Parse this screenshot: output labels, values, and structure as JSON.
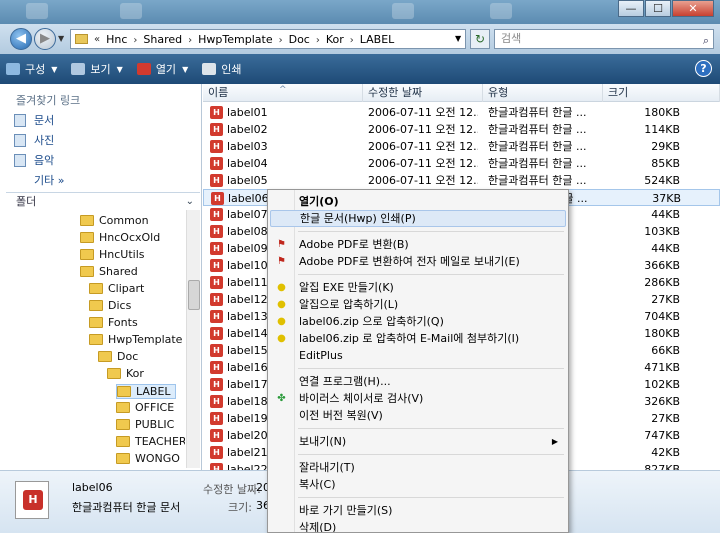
{
  "window": {
    "minimize_label": "—",
    "maximize_label": "☐",
    "close_label": "✕"
  },
  "address": {
    "history_glyph": "▼",
    "lead_glyph": "«",
    "crumbs": [
      "Hnc",
      "Shared",
      "HwpTemplate",
      "Doc",
      "Kor",
      "LABEL"
    ],
    "separator": "›",
    "dropdown_glyph": "▼",
    "refresh_glyph": "↻",
    "search_placeholder": "검색",
    "search_icon_glyph": "⌕"
  },
  "toolbar": {
    "organize": "구성",
    "views": "보기",
    "open": "열기",
    "print": "인쇄",
    "dropdown_glyph": "▼",
    "help": "?"
  },
  "nav": {
    "favorites_title": "즐겨찾기 링크",
    "favorites": [
      "문서",
      "사진",
      "음악"
    ],
    "more": "기타 »",
    "folders_label": "폴더",
    "folders_chevron": "⌄",
    "tree": [
      "Common",
      "HncOcxOld",
      "HncUtils",
      "Shared",
      "Clipart",
      "Dics",
      "Fonts",
      "HwpTemplate",
      "Doc",
      "Kor",
      "LABEL",
      "OFFICE",
      "PUBLIC",
      "TEACHER",
      "WONGO"
    ]
  },
  "list": {
    "sort_glyph": "^",
    "icon_glyph": "H",
    "columns": [
      "이름",
      "수정한 날짜",
      "유형",
      "크기"
    ],
    "rows": [
      {
        "name": "label01",
        "date": "2006-07-11 오전 12...",
        "type": "한글과컴퓨터 한글 ...",
        "size": "180KB"
      },
      {
        "name": "label02",
        "date": "2006-07-11 오전 12...",
        "type": "한글과컴퓨터 한글 ...",
        "size": "114KB"
      },
      {
        "name": "label03",
        "date": "2006-07-11 오전 12...",
        "type": "한글과컴퓨터 한글 ...",
        "size": "29KB"
      },
      {
        "name": "label04",
        "date": "2006-07-11 오전 12...",
        "type": "한글과컴퓨터 한글 ...",
        "size": "85KB"
      },
      {
        "name": "label05",
        "date": "2006-07-11 오전 12...",
        "type": "한글과컴퓨터 한글 ...",
        "size": "524KB"
      },
      {
        "name": "label06",
        "date": "2006-07-11 오전 12...",
        "type": "한글과컴퓨터 한글 ...",
        "size": "37KB"
      },
      {
        "name": "label07",
        "date": "",
        "type": "",
        "size": "44KB"
      },
      {
        "name": "label08",
        "date": "",
        "type": "",
        "size": "103KB"
      },
      {
        "name": "label09",
        "date": "",
        "type": "",
        "size": "44KB"
      },
      {
        "name": "label10",
        "date": "",
        "type": "",
        "size": "366KB"
      },
      {
        "name": "label11",
        "date": "",
        "type": "",
        "size": "286KB"
      },
      {
        "name": "label12",
        "date": "",
        "type": "",
        "size": "27KB"
      },
      {
        "name": "label13",
        "date": "",
        "type": "",
        "size": "704KB"
      },
      {
        "name": "label14",
        "date": "",
        "type": "",
        "size": "180KB"
      },
      {
        "name": "label15",
        "date": "",
        "type": "",
        "size": "66KB"
      },
      {
        "name": "label16",
        "date": "",
        "type": "",
        "size": "471KB"
      },
      {
        "name": "label17",
        "date": "",
        "type": "",
        "size": "102KB"
      },
      {
        "name": "label18",
        "date": "",
        "type": "",
        "size": "326KB"
      },
      {
        "name": "label19",
        "date": "",
        "type": "",
        "size": "27KB"
      },
      {
        "name": "label20",
        "date": "",
        "type": "",
        "size": "747KB"
      },
      {
        "name": "label21",
        "date": "",
        "type": "",
        "size": "42KB"
      },
      {
        "name": "label22",
        "date": "",
        "type": "",
        "size": "827KB"
      }
    ]
  },
  "details": {
    "name": "label06",
    "type": "한글과컴퓨터 한글 문서",
    "modified_label": "수정한 날짜:",
    "modified_value": "20",
    "size_label": "크기:",
    "size_value": "36"
  },
  "context_menu": {
    "items": [
      {
        "label": "열기(O)",
        "bold": true
      },
      {
        "label": "한글 문서(Hwp) 인쇄(P)",
        "highlight": true
      },
      {
        "sep": true
      },
      {
        "label": "Adobe PDF로 변환(B)",
        "icon": "pdf-icon"
      },
      {
        "label": "Adobe PDF로 변환하여 전자 메일로 보내기(E)",
        "icon": "pdf-mail-icon"
      },
      {
        "sep": true
      },
      {
        "label": "알집 EXE 만들기(K)",
        "icon": "alzip-icon"
      },
      {
        "label": "알집으로 압축하기(L)",
        "icon": "alzip-icon"
      },
      {
        "label": "label06.zip 으로 압축하기(Q)",
        "icon": "alzip-icon"
      },
      {
        "label": "label06.zip 로 압축하여 E-Mail에 첨부하기(I)",
        "icon": "alzip-icon"
      },
      {
        "label": "EditPlus"
      },
      {
        "sep": true
      },
      {
        "label": "연결 프로그램(H)..."
      },
      {
        "label": "바이러스 체이서로 검사(V)",
        "icon": "virus-icon"
      },
      {
        "label": "이전 버전 복원(V)"
      },
      {
        "sep": true
      },
      {
        "label": "보내기(N)",
        "submenu": true
      },
      {
        "sep": true
      },
      {
        "label": "잘라내기(T)"
      },
      {
        "label": "복사(C)"
      },
      {
        "sep": true
      },
      {
        "label": "바로 가기 만들기(S)"
      },
      {
        "label": "삭제(D)"
      }
    ],
    "icon_glyphs": {
      "pdf-icon": "⚑",
      "pdf-mail-icon": "⚑",
      "alzip-icon": "●",
      "virus-icon": "✤"
    },
    "icon_colors": {
      "pdf-icon": "#c0281e",
      "pdf-mail-icon": "#c0281e",
      "alzip-icon": "#e0c000",
      "virus-icon": "#2a9a3a"
    },
    "submenu_glyph": "▶"
  },
  "colors": {
    "toolbar": "#1e4a76",
    "selection": "#e6f1fc",
    "hwp_icon": "#d23a2e"
  }
}
